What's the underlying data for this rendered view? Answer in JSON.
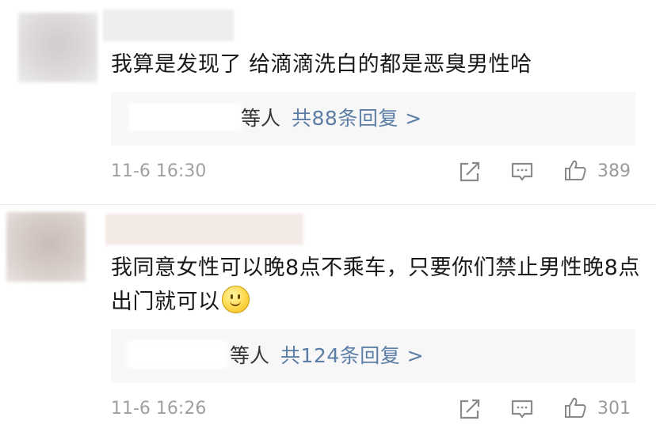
{
  "comments": [
    {
      "text": "我算是发现了 给滴滴洗白的都是恶臭男性哈",
      "reply_suffix": "等人",
      "reply_link": "共88条回复 >",
      "time": "11-6 16:30",
      "like_count": "389"
    },
    {
      "text": "我同意女性可以晚8点不乘车，只要你们禁止男性晚8点出门就可以",
      "reply_suffix": "等人",
      "reply_link": "共124条回复 >",
      "time": "11-6 16:26",
      "like_count": "301",
      "emoji": "smile-emoji"
    }
  ],
  "colors": {
    "link": "#5b7da6",
    "meta": "#a0a0a0",
    "reply_bg": "#f7f7f7"
  }
}
